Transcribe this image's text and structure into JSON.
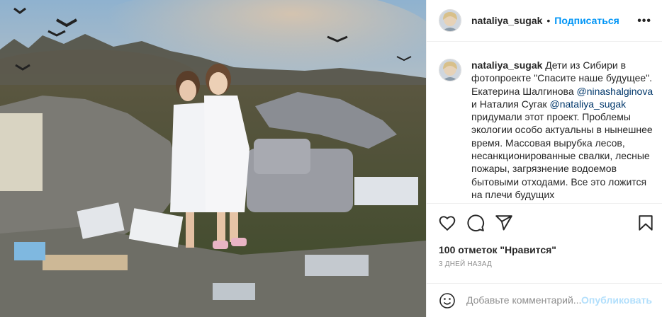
{
  "post": {
    "username": "nataliya_sugak",
    "separator": "•",
    "follow_label": "Подписаться",
    "more_label": "•••"
  },
  "caption": {
    "username": "nataliya_sugak",
    "text_1": "Дети из Сибири в фотопроекте \"Спасите наше будущее\". Екатерина Шалгинова ",
    "mention_1": "@ninashalginova",
    "text_2": " и Наталия Сугак ",
    "mention_2": "@nataliya_sugak",
    "text_3": " придумали этот проект. Проблемы экологии особо актуальны в нынешнее время. Массовая вырубка лесов, несанкционированные свалки, лесные пожары, загрязнение водоемов бытовыми отходами. Все это ложится на плечи будущих"
  },
  "actions": {
    "likes": "100 отметок \"Нравится\"",
    "time": "3 дней назад"
  },
  "comment_box": {
    "placeholder": "Добавьте комментарий...",
    "publish_label": "Опубликовать"
  },
  "colors": {
    "accent": "#0095f6",
    "mention": "#00376b",
    "muted": "#8e8e8e",
    "publish_disabled": "#b2dffc",
    "border": "#efefef"
  },
  "icons": {
    "like": "heart-icon",
    "comment": "comment-icon",
    "share": "share-icon",
    "save": "bookmark-icon",
    "emoji": "emoji-icon",
    "more": "more-options-icon"
  }
}
